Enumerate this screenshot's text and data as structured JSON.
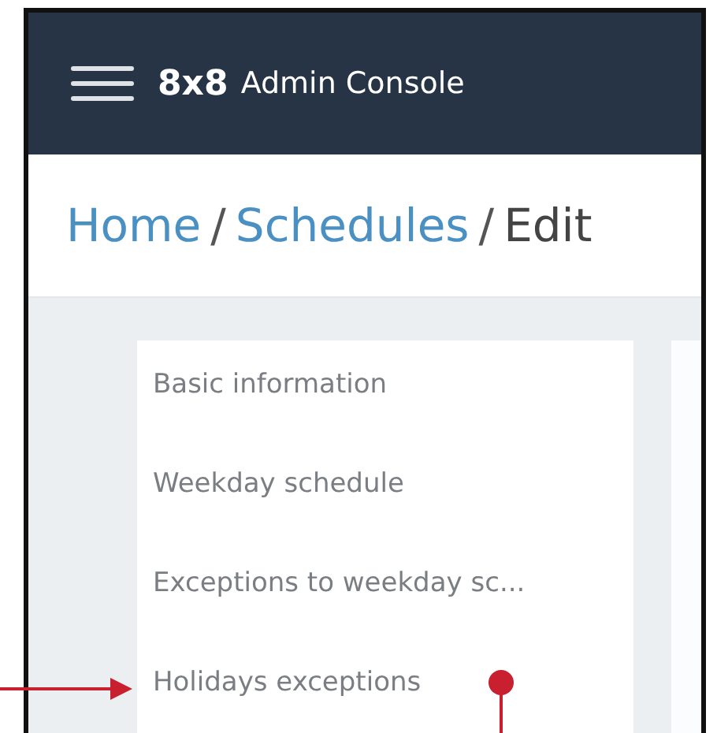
{
  "header": {
    "brand": "8x8",
    "title": "Admin Console"
  },
  "breadcrumb": [
    {
      "label": "Home",
      "kind": "link"
    },
    {
      "label": "/",
      "kind": "separator"
    },
    {
      "label": "Schedules",
      "kind": "link"
    },
    {
      "label": "/",
      "kind": "separator"
    },
    {
      "label": "Edit",
      "kind": "current"
    }
  ],
  "nav": {
    "items": [
      {
        "label": "Basic information"
      },
      {
        "label": "Weekday schedule"
      },
      {
        "label": "Exceptions to weekday sc..."
      },
      {
        "label": "Holidays exceptions"
      }
    ]
  }
}
